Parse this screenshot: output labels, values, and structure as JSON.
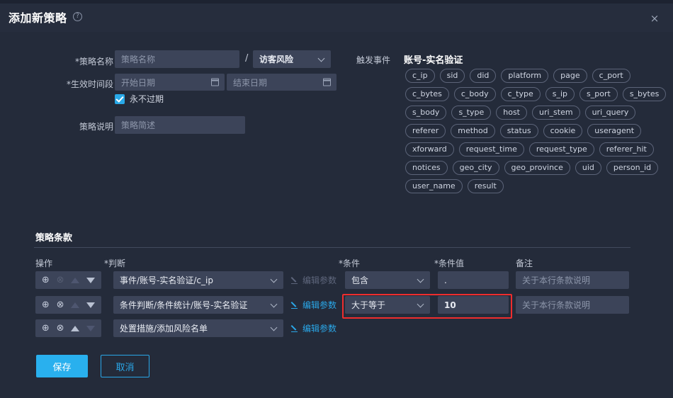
{
  "header": {
    "title": "添加新策略",
    "help_icon": "question-mark-icon",
    "close_icon": "×"
  },
  "form": {
    "name_label": "*策略名称",
    "name_placeholder": "策略名称",
    "name_value": "",
    "separator": "/",
    "category_value": "访客风险",
    "period_label": "*生效时间段",
    "start_placeholder": "开始日期",
    "end_placeholder": "结束日期",
    "never_expire_label": "永不过期",
    "never_expire_checked": true,
    "desc_label": "策略说明",
    "desc_placeholder": "策略简述"
  },
  "trigger": {
    "label": "触发事件",
    "value": "账号-实名验证",
    "tags": [
      "c_ip",
      "sid",
      "did",
      "platform",
      "page",
      "c_port",
      "c_bytes",
      "c_body",
      "c_type",
      "s_ip",
      "s_port",
      "s_bytes",
      "s_body",
      "s_type",
      "host",
      "uri_stem",
      "uri_query",
      "referer",
      "method",
      "status",
      "cookie",
      "useragent",
      "xforward",
      "request_time",
      "request_type",
      "referer_hit",
      "notices",
      "geo_city",
      "geo_province",
      "uid",
      "person_id",
      "user_name",
      "result"
    ]
  },
  "terms": {
    "section_title": "策略条款",
    "columns": {
      "operation": "操作",
      "judgment": "*判断",
      "condition": "*条件",
      "condition_value": "*条件值",
      "remark": "备注"
    },
    "edit_params_label": "编辑参数",
    "remark_placeholder": "关于本行条款说明",
    "rows": [
      {
        "ops": {
          "add": "enabled",
          "remove": "disabled",
          "up": "disabled",
          "down": "enabled"
        },
        "judgment": "事件/账号-实名验证/c_ip",
        "edit_params": "disabled",
        "condition": "包含",
        "condition_value": ".",
        "remark": "",
        "has_condition": true,
        "highlighted": false
      },
      {
        "ops": {
          "add": "enabled",
          "remove": "enabled",
          "up": "disabled",
          "down": "enabled"
        },
        "judgment": "条件判断/条件统计/账号-实名验证",
        "edit_params": "enabled",
        "condition": "大于等于",
        "condition_value": "10",
        "remark": "",
        "has_condition": true,
        "highlighted": true
      },
      {
        "ops": {
          "add": "enabled",
          "remove": "enabled",
          "up": "enabled",
          "down": "disabled"
        },
        "judgment": "处置措施/添加风险名单",
        "edit_params": "enabled",
        "condition": "",
        "condition_value": "",
        "remark": "",
        "has_condition": false,
        "highlighted": false
      }
    ]
  },
  "footer": {
    "save_label": "保存",
    "cancel_label": "取消"
  },
  "colors": {
    "background": "#242b3a",
    "header_bg": "#262d3d",
    "field_bg": "#3c4459",
    "accent": "#29a9e8",
    "highlight": "#ef2d2d",
    "text": "#e9ecf3",
    "muted": "#8d96aa"
  }
}
